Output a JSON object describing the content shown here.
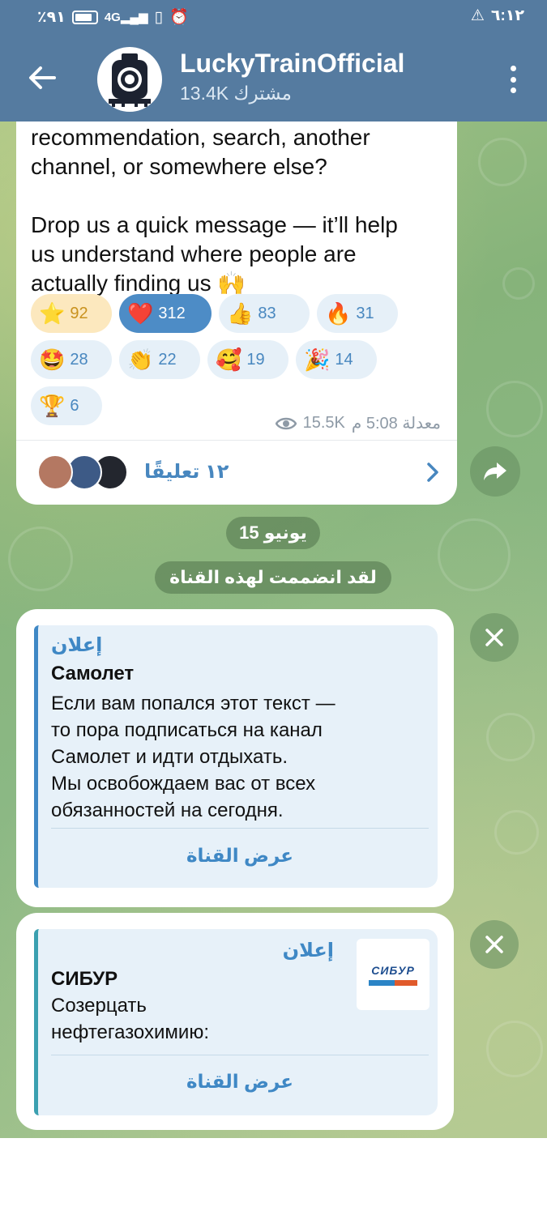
{
  "status_bar": {
    "battery_percent": "٪٩١",
    "network": "4G",
    "time": "٦:١٢"
  },
  "header": {
    "title": "LuckyTrainOfficial",
    "subscribers": "13.4K مشترك"
  },
  "post": {
    "text": "recommendation, search, another\nchannel, or somewhere else?\n\nDrop us a quick message — it’ll help\nus understand where people are\nactually finding us 🙌",
    "reactions": [
      {
        "emoji": "⭐",
        "count": "92"
      },
      {
        "emoji": "❤️",
        "count": "312"
      },
      {
        "emoji": "👍",
        "count": "83"
      },
      {
        "emoji": "🔥",
        "count": "31"
      },
      {
        "emoji": "🤩",
        "count": "28"
      },
      {
        "emoji": "👏",
        "count": "22"
      },
      {
        "emoji": "🥰",
        "count": "19"
      },
      {
        "emoji": "🎉",
        "count": "14"
      },
      {
        "emoji": "🏆",
        "count": "6"
      }
    ],
    "views": "15.5K",
    "edited_time": "معدلة 5:08 م",
    "comments_label": "١٢ تعليقًا"
  },
  "date_pill": "15 يونيو",
  "joined_pill": "لقد انضممت لهذه القناة",
  "ads": [
    {
      "label": "إعلان",
      "title": "Самолет",
      "body": "Если вам попался этот текст —\nто пора подписаться на канал\nСамолет и идти отдыхать.\nМы освобождаем вас от всех\nобязанностей на сегодня.",
      "button": "عرض القناة"
    },
    {
      "label": "إعلان",
      "title": "СИБУР",
      "body": "Созерцать\nнефтегазохимию:",
      "button": "عرض القناة",
      "logo_text": "СИБУР"
    }
  ],
  "colors": {
    "header": "#557ba0",
    "accent": "#3f88c5",
    "bubble": "#ffffff",
    "wallpaper": "#8bb884"
  }
}
